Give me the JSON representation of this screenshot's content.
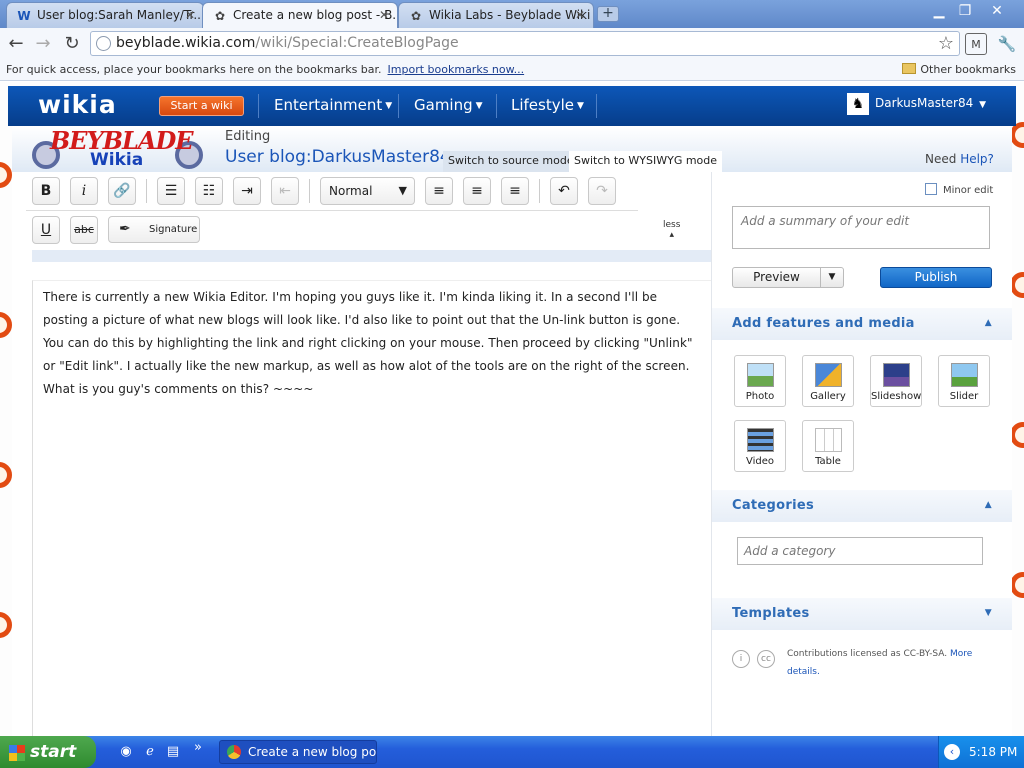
{
  "browser": {
    "tabs": [
      {
        "label": "User blog:Sarah Manley/Tr...",
        "favicon": "W",
        "active": false
      },
      {
        "label": "Create a new blog post - B...",
        "favicon": "✿",
        "active": true
      },
      {
        "label": "Wikia Labs - Beyblade Wiki ...",
        "favicon": "✿",
        "active": false
      }
    ],
    "url_host": "beyblade.wikia.com",
    "url_path": "/wiki/Special:CreateBlogPage",
    "bookmarks_msg": "For quick access, place your bookmarks here on the bookmarks bar.",
    "bookmarks_import": "Import bookmarks now...",
    "bookmarks_other": "Other bookmarks"
  },
  "wikia": {
    "logo": "wikia",
    "start_wiki": "Start a wiki",
    "nav": [
      "Entertainment",
      "Gaming",
      "Lifestyle"
    ],
    "username": "DarkusMaster84"
  },
  "editor": {
    "site_logo_line1": "BEYBLADE",
    "site_logo_line2": "Wikia",
    "editing_label": "Editing",
    "page_title": "User blog:DarkusMaster84/Wi",
    "source_mode": "Switch to source mode",
    "wysiwyg_mode": "Switch to WYSIWYG mode",
    "need_help_prefix": "Need",
    "need_help_link": "Help?",
    "format_select": "Normal",
    "signature": "Signature",
    "less": "less",
    "body_text": "There is currently a new Wikia Editor. I'm hoping you guys like it. I'm kinda liking it. In a second I'll be posting a picture of what new blogs will look like. I'd also like to point out that the Un-link button is gone. You can do this by highlighting the link and right clicking on your mouse. Then proceed by clicking \"Unlink\" or \"Edit link\". I actually like the new markup, as well as how alot of the tools are on the right of the screen. What is you guy's comments on this? ~~~~"
  },
  "rail": {
    "minor_edit": "Minor edit",
    "summary_placeholder": "Add a summary of your edit",
    "preview": "Preview",
    "publish": "Publish",
    "features_title": "Add features and media",
    "media": [
      "Photo",
      "Gallery",
      "Slideshow",
      "Slider",
      "Video",
      "Table"
    ],
    "categories_title": "Categories",
    "category_placeholder": "Add a category",
    "templates_title": "Templates",
    "license_text": "Contributions licensed as CC-BY-SA.",
    "license_link": "More details."
  },
  "taskbar": {
    "start": "start",
    "task_label": "Create a new blog po...",
    "clock": "5:18 PM"
  }
}
